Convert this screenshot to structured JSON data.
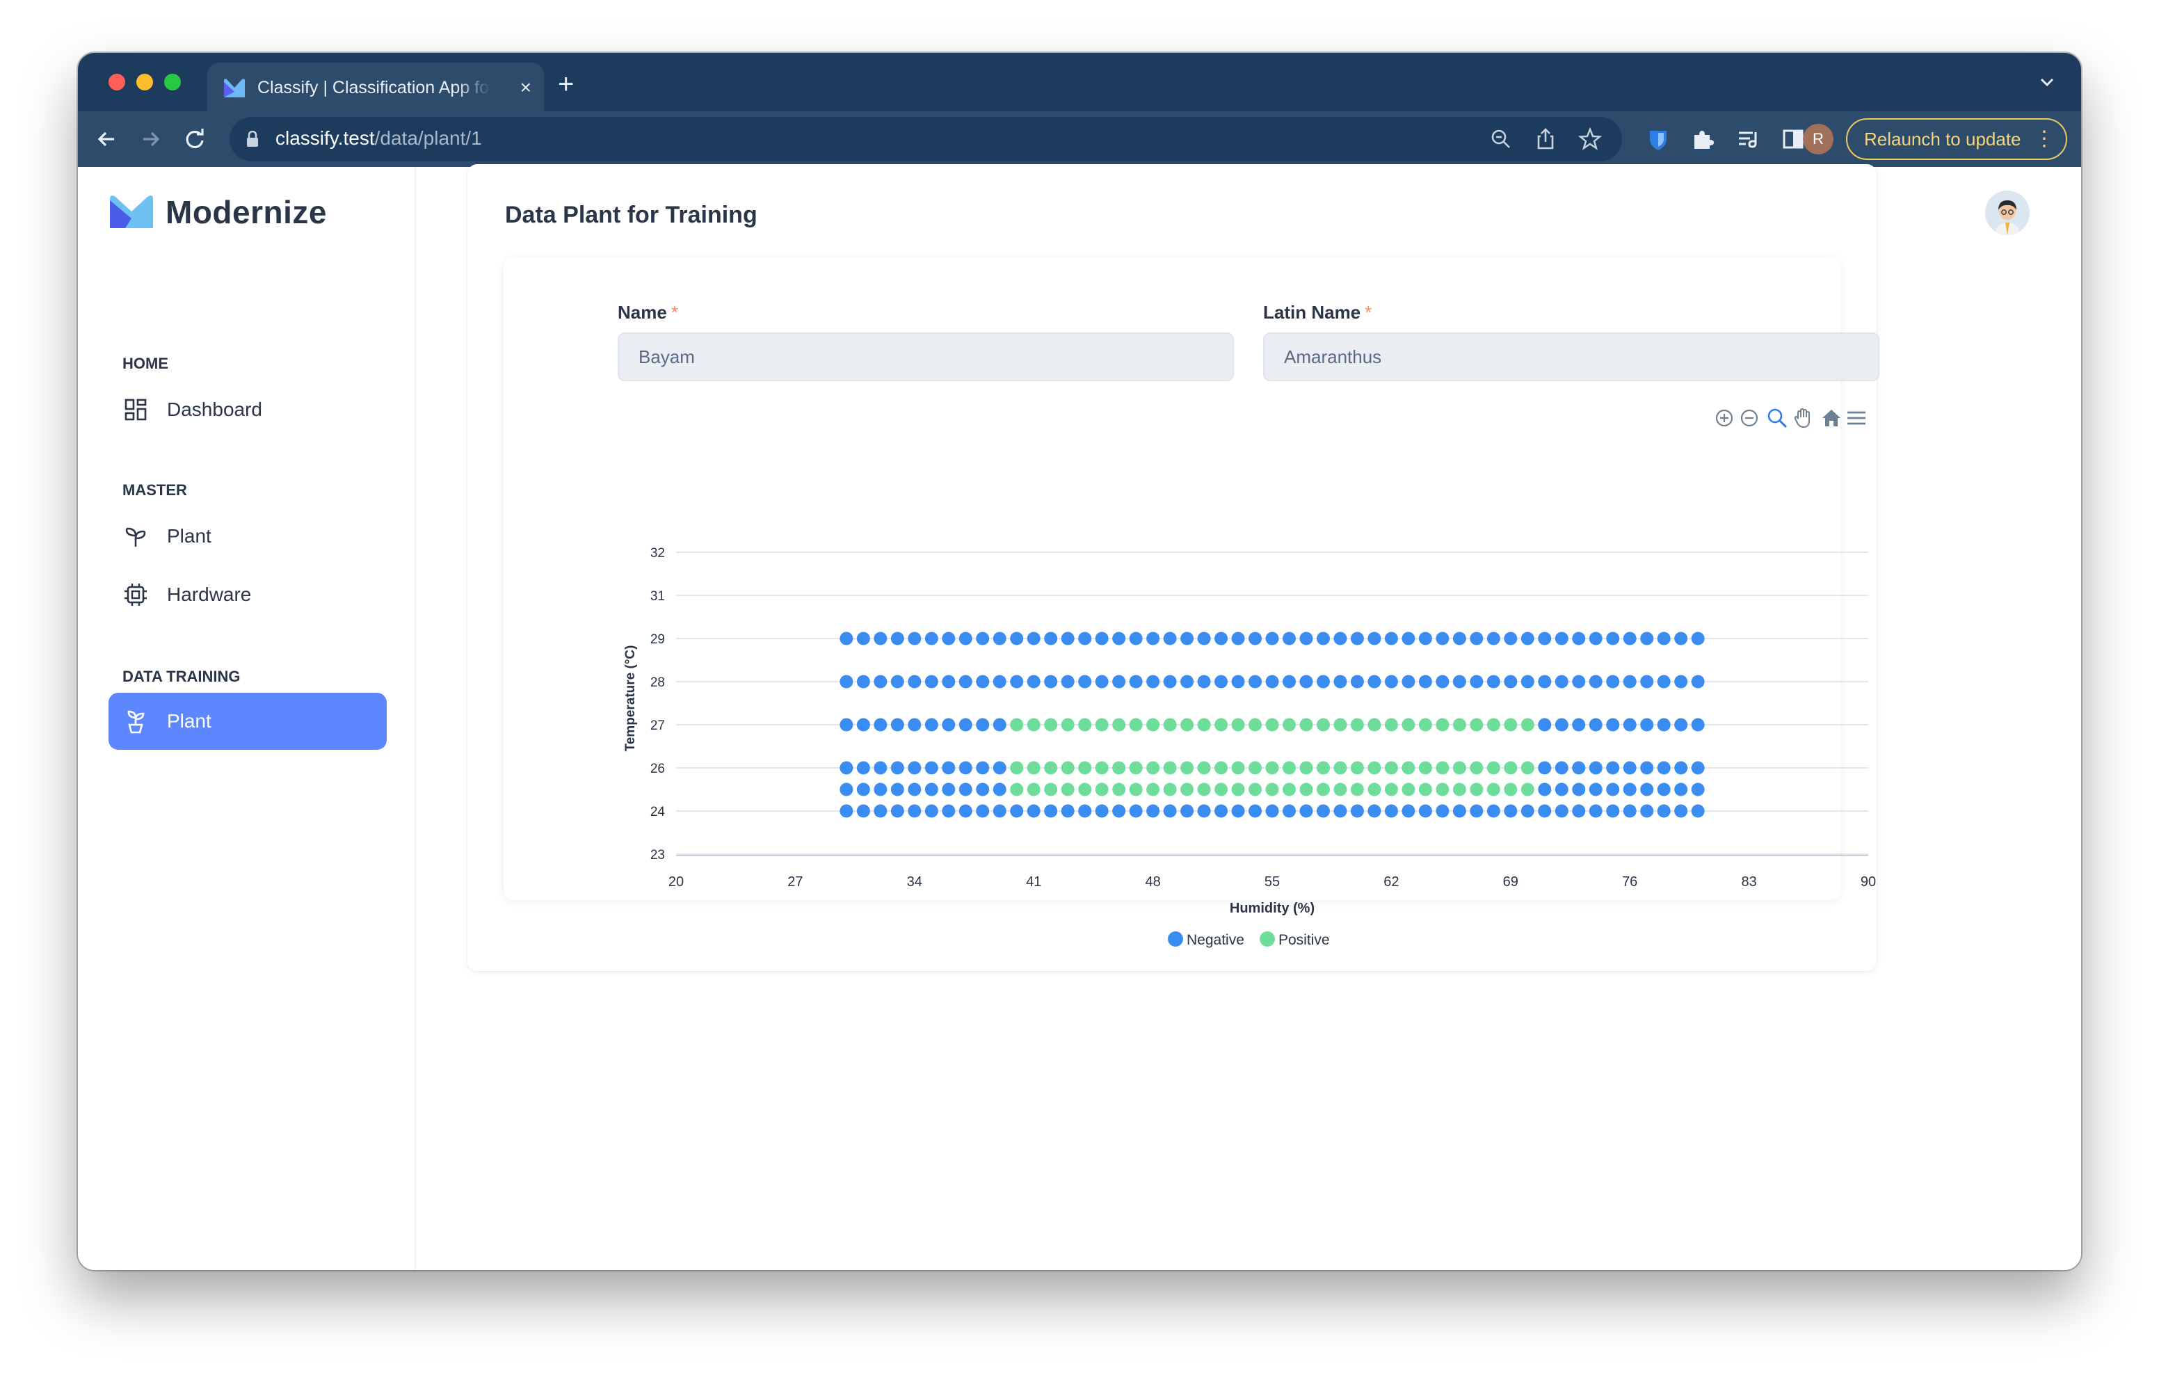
{
  "browser": {
    "tab_title": "Classify | Classification App for Plant",
    "tab_close": "×",
    "new_tab": "+",
    "url_host": "classify.test",
    "url_path": "/data/plant/1",
    "profile_initial": "R",
    "relaunch_label": "Relaunch to update",
    "relaunch_menu": "⋮"
  },
  "app": {
    "brand": "Modernize",
    "sidebar": {
      "sections": [
        {
          "title": "HOME",
          "items": [
            {
              "label": "Dashboard",
              "icon": "dashboard-icon"
            }
          ]
        },
        {
          "title": "MASTER",
          "items": [
            {
              "label": "Plant",
              "icon": "sprout-icon"
            },
            {
              "label": "Hardware",
              "icon": "cpu-icon"
            }
          ]
        },
        {
          "title": "DATA TRAINING",
          "items": [
            {
              "label": "Plant",
              "icon": "plant-pot-icon",
              "active": true
            }
          ]
        }
      ]
    },
    "accent": "#5d87ff"
  },
  "page": {
    "title": "Data Plant for Training",
    "name_label": "Name",
    "name_value": "Bayam",
    "latin_label": "Latin Name",
    "latin_value": "Amaranthus",
    "required_mark": "*"
  },
  "chart_data": {
    "type": "scatter",
    "xlabel": "Humidity (%)",
    "ylabel": "Temperature (°C)",
    "x_ticks": [
      "20",
      "27",
      "34",
      "41",
      "48",
      "55",
      "62",
      "69",
      "76",
      "83",
      "90"
    ],
    "y_ticks": [
      "32",
      "31",
      "29",
      "28",
      "27",
      "26",
      "24",
      "23"
    ],
    "xlim": [
      20,
      90
    ],
    "ylim": [
      23,
      32
    ],
    "grid": "horizontal",
    "legend_position": "bottom-center",
    "rows": [
      {
        "temperature": 29,
        "x_from": 30,
        "x_to": 80
      },
      {
        "temperature": 28,
        "x_from": 30,
        "x_to": 80
      },
      {
        "temperature": 27,
        "x_from": 30,
        "x_to": 80
      },
      {
        "temperature": 26,
        "x_from": 30,
        "x_to": 80
      },
      {
        "temperature": 25,
        "x_from": 30,
        "x_to": 80
      },
      {
        "temperature": 24,
        "x_from": 30,
        "x_to": 80
      }
    ],
    "x_step": 1,
    "positive_region": {
      "temperatures": [
        27,
        26,
        25
      ],
      "x_from": 40,
      "x_to": 70
    },
    "series": [
      {
        "name": "Negative",
        "color": "#3b8cf0"
      },
      {
        "name": "Positive",
        "color": "#6fdd9a"
      }
    ]
  }
}
